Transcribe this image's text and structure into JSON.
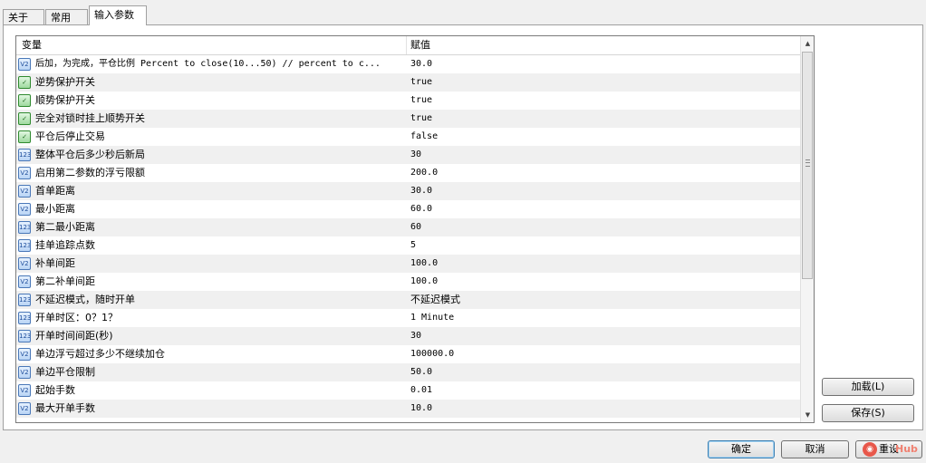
{
  "tabs": [
    {
      "label": "关于"
    },
    {
      "label": "常用"
    },
    {
      "label": "输入参数"
    }
  ],
  "grid": {
    "headers": {
      "variable": "变量",
      "value": "赋值"
    },
    "rows": [
      {
        "name": "后加，为完成，平仓比例 Percent to close(10...50) // percent to c...",
        "value": "30.0",
        "type": "double"
      },
      {
        "name": "逆势保护开关",
        "value": "true",
        "type": "bool"
      },
      {
        "name": "顺势保护开关",
        "value": "true",
        "type": "bool"
      },
      {
        "name": "完全对锁时挂上顺势开关",
        "value": "true",
        "type": "bool"
      },
      {
        "name": "平仓后停止交易",
        "value": "false",
        "type": "bool"
      },
      {
        "name": "整体平仓后多少秒后新局",
        "value": "30",
        "type": "int"
      },
      {
        "name": "启用第二参数的浮亏限额",
        "value": "200.0",
        "type": "double"
      },
      {
        "name": "首单距离",
        "value": "30.0",
        "type": "double"
      },
      {
        "name": "最小距离",
        "value": "60.0",
        "type": "double"
      },
      {
        "name": "第二最小距离",
        "value": "60",
        "type": "int"
      },
      {
        "name": "挂单追踪点数",
        "value": "5",
        "type": "int"
      },
      {
        "name": "补单间距",
        "value": "100.0",
        "type": "double"
      },
      {
        "name": "第二补单间距",
        "value": "100.0",
        "type": "double"
      },
      {
        "name": "不延迟模式，随时开单",
        "value": "不延迟模式",
        "type": "int"
      },
      {
        "name": "开单时区：0？1？",
        "value": "1 Minute",
        "type": "int"
      },
      {
        "name": "开单时间间距(秒)",
        "value": "30",
        "type": "int"
      },
      {
        "name": "单边浮亏超过多少不继续加仓",
        "value": "100000.0",
        "type": "double"
      },
      {
        "name": "单边平仓限制",
        "value": "50.0",
        "type": "double"
      },
      {
        "name": "起始手数",
        "value": "0.01",
        "type": "double"
      },
      {
        "name": "最大开单手数",
        "value": "10.0",
        "type": "double"
      }
    ],
    "icon_labels": {
      "double": "V2",
      "int": "123",
      "bool": "✓"
    }
  },
  "side_buttons": {
    "load": "加载(L)",
    "save": "保存(S)"
  },
  "footer_buttons": {
    "ok": "确定",
    "cancel": "取消",
    "reset": "重设"
  },
  "watermark": {
    "text": "Hub"
  }
}
